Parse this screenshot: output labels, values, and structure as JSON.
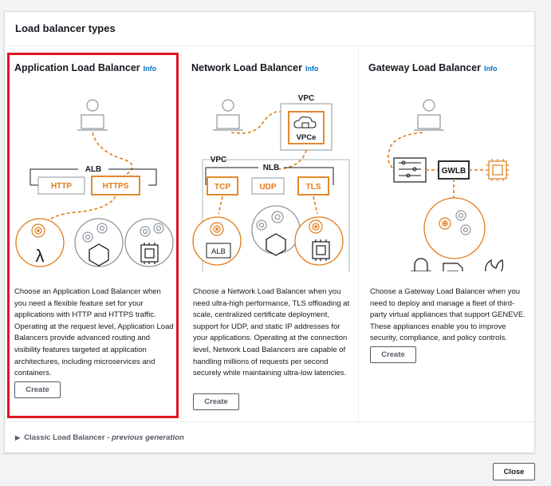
{
  "panel": {
    "title": "Load balancer types"
  },
  "cards": [
    {
      "title": "Application Load Balancer",
      "info": "Info",
      "description": "Choose an Application Load Balancer when you need a flexible feature set for your applications with HTTP and HTTPS traffic. Operating at the request level, Application Load Balancers provide advanced routing and visibility features targeted at application architectures, including microservices and containers.",
      "create_label": "Create",
      "diagram": {
        "group": "ALB",
        "protocols": [
          "HTTP",
          "HTTPS"
        ]
      },
      "selected": true
    },
    {
      "title": "Network Load Balancer",
      "info": "Info",
      "description": "Choose a Network Load Balancer when you need ultra-high performance, TLS offloading at scale, centralized certificate deployment, support for UDP, and static IP addresses for your applications. Operating at the connection level, Network Load Balancers are capable of handling millions of requests per second securely while maintaining ultra-low latencies.",
      "create_label": "Create",
      "diagram": {
        "vpc_top": "VPC",
        "vpce": "VPCe",
        "vpc": "VPC",
        "group": "NLB",
        "protocols": [
          "TCP",
          "UDP",
          "TLS"
        ],
        "target": "ALB"
      }
    },
    {
      "title": "Gateway Load Balancer",
      "info": "Info",
      "description": "Choose a Gateway Load Balancer when you need to deploy and manage a fleet of third-party virtual appliances that support GENEVE. These appliances enable you to improve security, compliance, and policy controls.",
      "create_label": "Create",
      "diagram": {
        "group": "GWLB"
      }
    }
  ],
  "classic": {
    "label": "Classic Load Balancer",
    "separator": " - ",
    "sub": "previous generation"
  },
  "footer": {
    "close_label": "Close"
  },
  "colors": {
    "orange": "#e07b17",
    "gray": "#8d969e",
    "red": "#e0151f",
    "link": "#0073bb"
  }
}
